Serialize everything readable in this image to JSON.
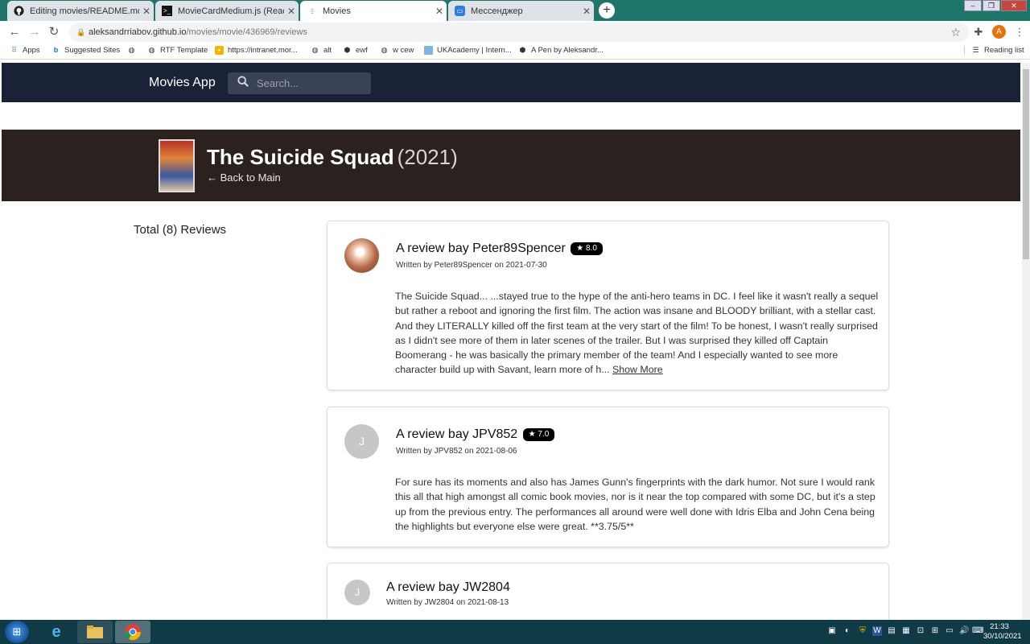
{
  "browser": {
    "tabs": [
      {
        "title": "Editing movies/README.md at m",
        "icon": "github-icon"
      },
      {
        "title": "MovieCardMedium.js (React-plus",
        "icon": "terminal-icon"
      },
      {
        "title": "Movies",
        "icon": "loading-icon"
      },
      {
        "title": "Мессенджер",
        "icon": "messenger-icon"
      }
    ],
    "new_tab": "+",
    "url_host": "aleksandrriabov.github.io",
    "url_path": "/movies/movie/436969/reviews",
    "bookmarks": [
      {
        "label": "Apps",
        "icon": "apps-grid-icon"
      },
      {
        "label": "Suggested Sites",
        "icon": "bing-icon"
      },
      {
        "label": "",
        "icon": "globe-icon"
      },
      {
        "label": "RTF Template",
        "icon": "globe-icon"
      },
      {
        "label": "https://intranet.mor...",
        "icon": "folder-icon"
      },
      {
        "label": "alt",
        "icon": "globe-icon"
      },
      {
        "label": "ewf",
        "icon": "codepen-icon"
      },
      {
        "label": "w cew",
        "icon": "globe-icon"
      },
      {
        "label": "UKAcademy | Intern...",
        "icon": "page-icon"
      },
      {
        "label": "A Pen by Aleksandr...",
        "icon": "codepen-icon"
      }
    ],
    "reading_list": "Reading list",
    "profile_initial": "A"
  },
  "app": {
    "brand": "Movies App",
    "search_placeholder": "Search..."
  },
  "movie": {
    "title": "The Suicide Squad",
    "year": "(2021)",
    "back_link": "← Back to Main"
  },
  "reviews": {
    "total_label": "Total (8) Reviews",
    "items": [
      {
        "title": "A review bay Peter89Spencer",
        "rating": "★ 8.0",
        "written": "Written by Peter89Spencer on 2021-07-30",
        "avatar_initial": "",
        "body": "The Suicide Squad... ...stayed true to the hype of the anti-hero teams in DC. I feel like it wasn't really a sequel but rather a reboot and ignoring the first film. The action was insane and BLOODY brilliant, with a stellar cast. And they LITERALLY killed off the first team at the very start of the film! To be honest, I wasn't really surprised as I didn't see more of them in later scenes of the trailer. But I was surprised they killed off Captain Boomerang - he was basically the primary member of the team! And I especially wanted to see more character build up with Savant, learn more of h...",
        "show_more": "Show More"
      },
      {
        "title": "A review bay JPV852",
        "rating": "★ 7.0",
        "written": "Written by JPV852 on 2021-08-06",
        "avatar_initial": "J",
        "body": "For sure has its moments and also has James Gunn's fingerprints with the dark humor. Not sure I would rank this all that high amongst all comic book movies, nor is it near the top compared with some DC, but it's a step up from the previous entry. The performances all around were well done with Idris Elba and John Cena being the highlights but everyone else were great. **3.75/5**"
      },
      {
        "title": "A review bay JW2804",
        "written": "Written by JW2804 on 2021-08-13",
        "avatar_initial": "J"
      }
    ]
  },
  "taskbar": {
    "time": "21:33",
    "date": "30/10/2021"
  }
}
